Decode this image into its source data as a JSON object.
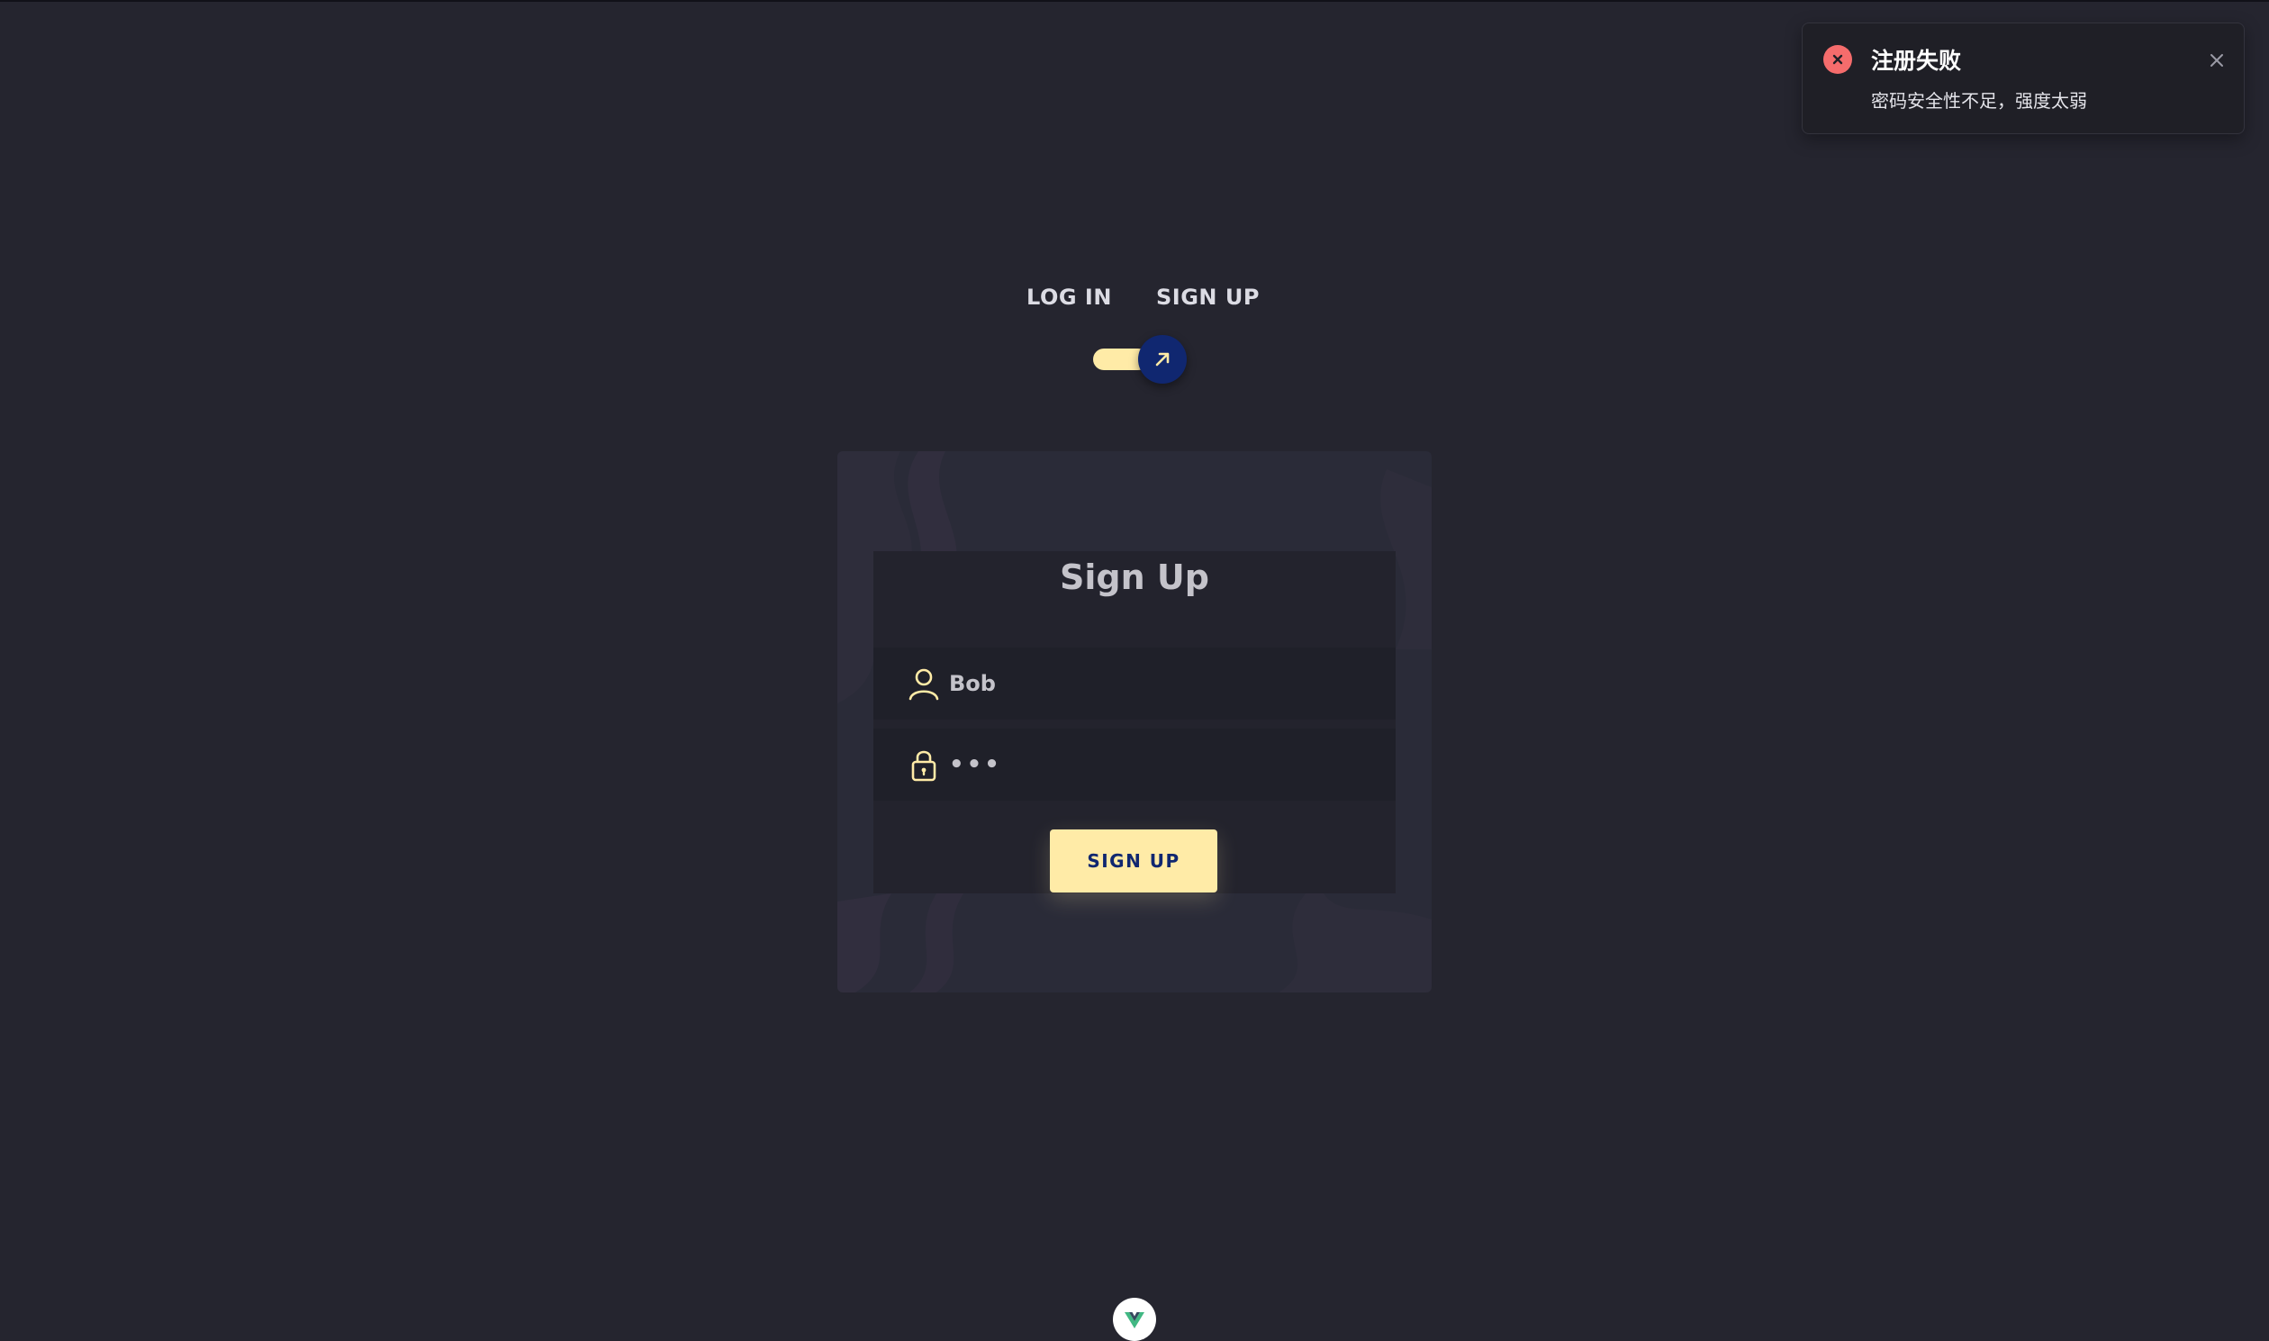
{
  "toast": {
    "title": "注册失败",
    "message": "密码安全性不足，强度太弱",
    "icon": "error-circle-icon",
    "close_icon": "close-icon",
    "color": "#f56c6c"
  },
  "tabs": {
    "login_label": "LOG IN",
    "signup_label": "SIGN UP"
  },
  "toggle": {
    "state": "sign-up",
    "icon": "arrow-up-right-icon"
  },
  "form": {
    "title": "Sign Up",
    "username_value": "Bob",
    "username_icon": "user-icon",
    "password_value": "•••",
    "password_icon": "lock-icon",
    "submit_label": "SIGN UP"
  },
  "colors": {
    "background": "#25252f",
    "accent": "#ffeba7",
    "accent_dark": "#102770",
    "card": "#2a2b38"
  }
}
